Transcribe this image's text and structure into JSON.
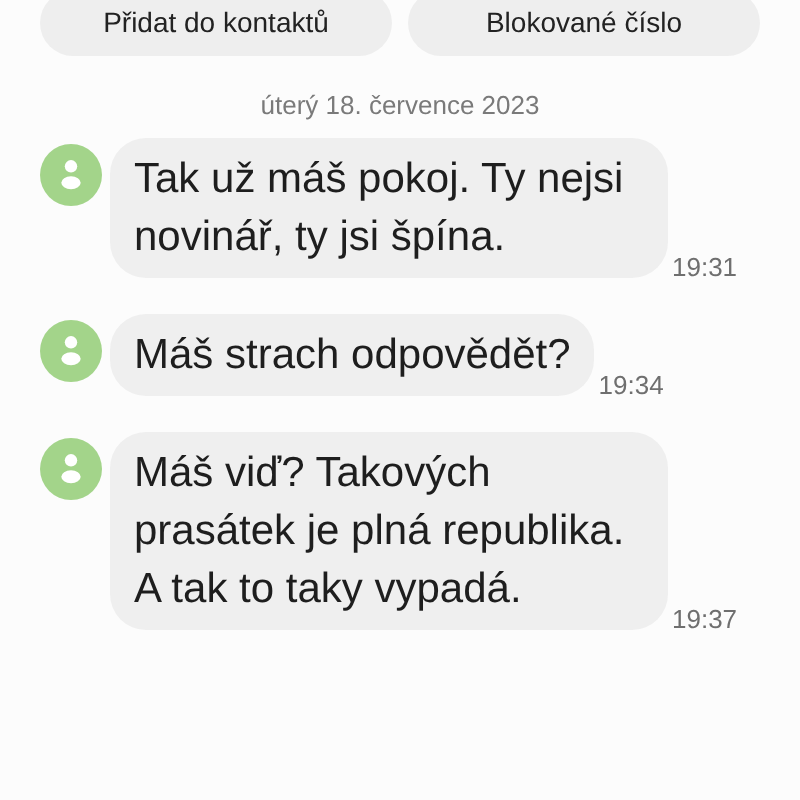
{
  "actions": [
    {
      "label": "Přidat do kontaktů"
    },
    {
      "label": "Blokované číslo"
    }
  ],
  "date_separator": "úterý 18. července 2023",
  "messages": [
    {
      "text": "Tak už máš pokoj. Ty nejsi novinář, ty jsi špína.",
      "time": "19:31"
    },
    {
      "text": "Máš strach odpovědět?",
      "time": "19:34"
    },
    {
      "text": "Máš viď? Takových prasátek je plná republika. A tak to taky vypadá.",
      "time": "19:37"
    }
  ]
}
